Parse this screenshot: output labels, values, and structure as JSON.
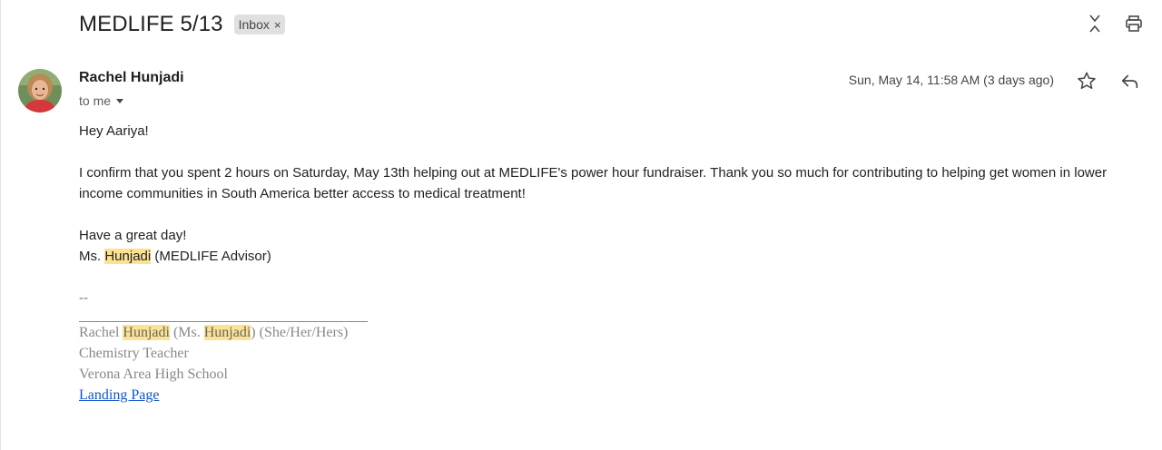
{
  "email": {
    "subject": "MEDLIFE 5/13",
    "label": "Inbox",
    "label_remove": "×",
    "sender": "Rachel Hunjadi",
    "recipient_text": "to me",
    "date": "Sun, May 14, 11:58 AM (3 days ago)"
  },
  "body": {
    "greeting": "Hey Aariya!",
    "paragraph": "I confirm that you spent 2 hours on Saturday, May 13th helping out at MEDLIFE's power hour fundraiser. Thank you so much for contributing to helping get women in lower income communities in South America better access to medical treatment!",
    "closing": "Have a great day!",
    "signoff_prefix": "Ms. ",
    "signoff_name": "Hunjadi",
    "signoff_suffix": " (MEDLIFE Advisor)",
    "separator": "--"
  },
  "signature": {
    "first": "Rachel ",
    "highlight1": "Hunjadi",
    "mid": " (Ms. ",
    "highlight2": "Hunjadi",
    "pronouns": ") (She/Her/Hers)",
    "title": "Chemistry Teacher",
    "school": "Verona Area High School",
    "link": "Landing Page"
  },
  "icons": {
    "collapse": "collapse-all-icon",
    "print": "print-icon",
    "star": "star-icon",
    "reply": "reply-icon"
  },
  "colors": {
    "highlight": "#fde293",
    "link": "#1155cc",
    "chip": "#e0e0e0"
  }
}
